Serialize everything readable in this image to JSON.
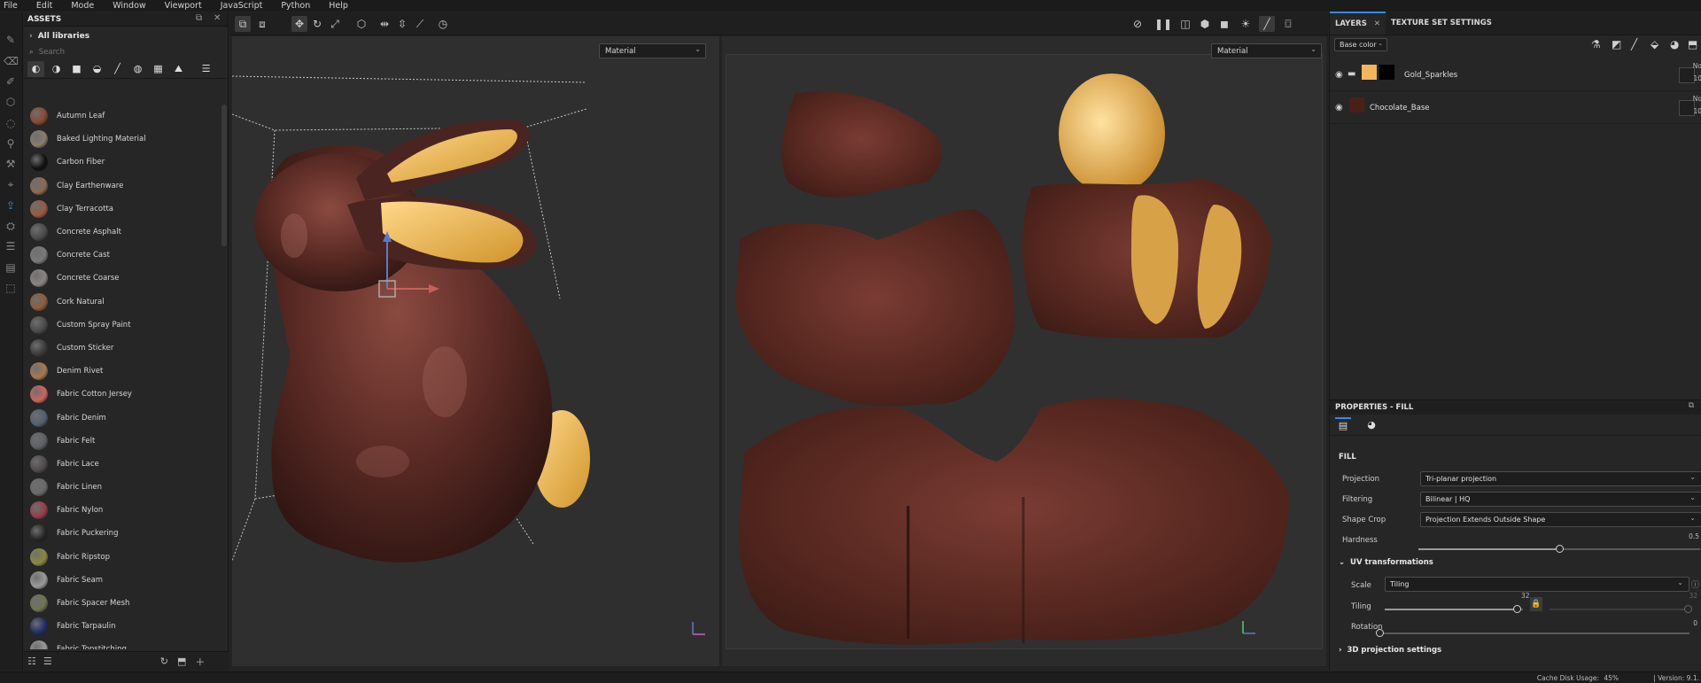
{
  "menu": [
    "File",
    "Edit",
    "Mode",
    "Window",
    "Viewport",
    "JavaScript",
    "Python",
    "Help"
  ],
  "assets": {
    "title": "ASSETS",
    "library": "All libraries",
    "search_placeholder": "Search",
    "items": [
      {
        "label": "Autumn Leaf",
        "color": "#8a4a2e"
      },
      {
        "label": "Baked Lighting Material",
        "color": "#8a7d6a"
      },
      {
        "label": "Carbon Fiber",
        "color": "#111111"
      },
      {
        "label": "Clay Earthenware",
        "color": "#8b6b52"
      },
      {
        "label": "Clay Terracotta",
        "color": "#9a5a3e"
      },
      {
        "label": "Concrete Asphalt",
        "color": "#4a4a4a"
      },
      {
        "label": "Concrete Cast",
        "color": "#7a7a7a"
      },
      {
        "label": "Concrete Coarse",
        "color": "#8a8580"
      },
      {
        "label": "Cork Natural",
        "color": "#8e5d3c"
      },
      {
        "label": "Custom Spray Paint",
        "color": "#4a4a4a"
      },
      {
        "label": "Custom Sticker",
        "color": "#3a3a3a"
      },
      {
        "label": "Denim Rivet",
        "color": "#a8794a"
      },
      {
        "label": "Fabric Cotton Jersey",
        "color": "#d0645c"
      },
      {
        "label": "Fabric Denim",
        "color": "#53606f"
      },
      {
        "label": "Fabric Felt",
        "color": "#5c6066"
      },
      {
        "label": "Fabric Lace",
        "color": "#4e4a4c"
      },
      {
        "label": "Fabric Linen",
        "color": "#6a6a6a"
      },
      {
        "label": "Fabric Nylon",
        "color": "#9a3c4a"
      },
      {
        "label": "Fabric Puckering",
        "color": "#262626"
      },
      {
        "label": "Fabric Ripstop",
        "color": "#8a8a3a"
      },
      {
        "label": "Fabric Seam",
        "color": "#9a9a9a"
      },
      {
        "label": "Fabric Spacer Mesh",
        "color": "#6e7550"
      },
      {
        "label": "Fabric Tarpaulin",
        "color": "#1f2e6a"
      },
      {
        "label": "Fabric Topstitching",
        "color": "#9a9a9a"
      }
    ]
  },
  "viewport": {
    "left_material": "Material",
    "right_material": "Material"
  },
  "layers": {
    "tab_layers": "LAYERS",
    "tab_texture": "TEXTURE SET SETTINGS",
    "channel": "Base color",
    "rows": [
      {
        "name": "Gold_Sparkles",
        "blend": "No",
        "opacity": "10",
        "color": "#f0b85a"
      },
      {
        "name": "Chocolate_Base",
        "blend": "No",
        "opacity": "10",
        "color": "#4a1f18"
      }
    ]
  },
  "properties": {
    "title": "PROPERTIES - FILL",
    "section_fill": "FILL",
    "projection_label": "Projection",
    "projection_value": "Tri-planar projection",
    "filtering_label": "Filtering",
    "filtering_value": "Bilinear | HQ",
    "shapecrop_label": "Shape Crop",
    "shapecrop_value": "Projection Extends Outside Shape",
    "hardness_label": "Hardness",
    "hardness_value": "0.5",
    "uv_section": "UV transformations",
    "scale_label": "Scale",
    "scale_value": "Tiling",
    "tiling_label": "Tiling",
    "tiling_value": "32",
    "tiling_value2": "32",
    "rotation_label": "Rotation",
    "rotation_value": "0",
    "proj3d_section": "3D projection settings"
  },
  "status": {
    "cache": "Cache Disk Usage:",
    "cache_value": "45%",
    "version": "| Version: 9.1."
  }
}
